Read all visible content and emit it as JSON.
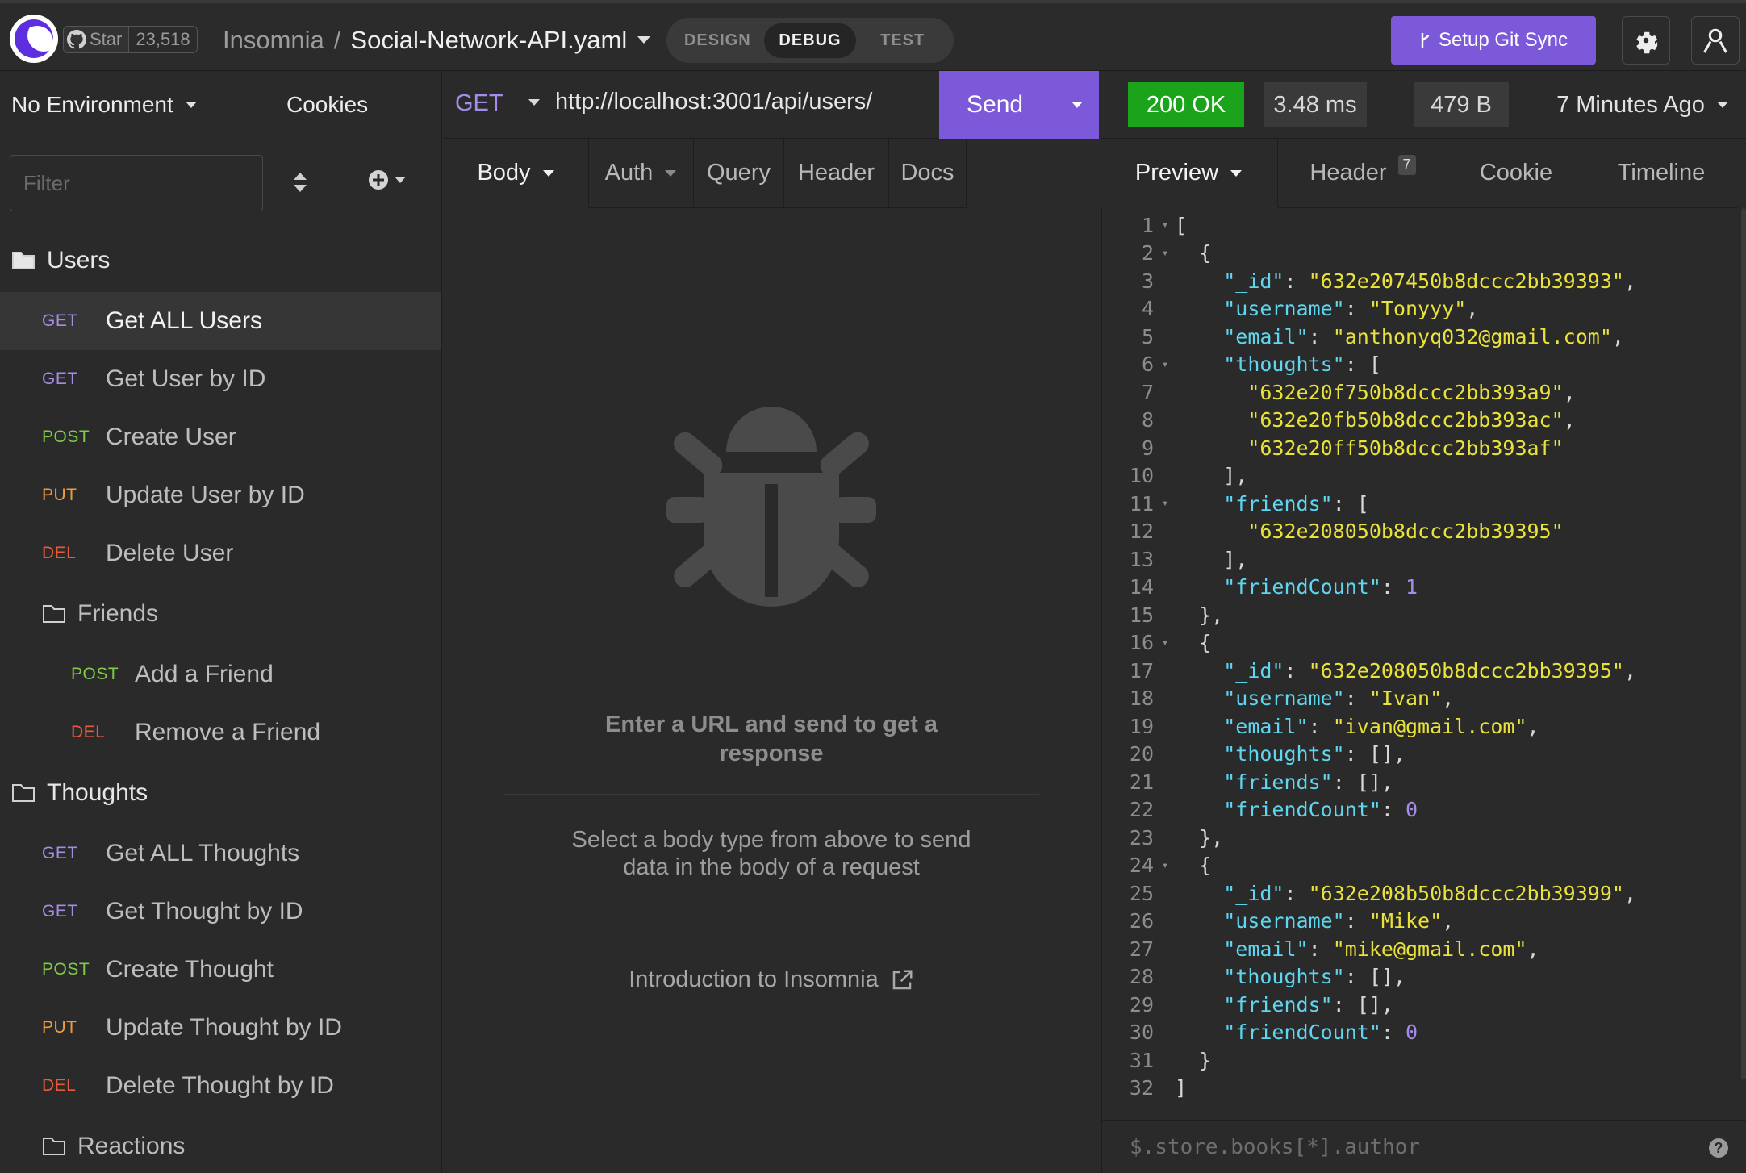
{
  "header": {
    "star_label": "Star",
    "star_count": "23,518",
    "org": "Insomnia",
    "separator": "/",
    "document": "Social-Network-API.yaml",
    "modes": [
      "DESIGN",
      "DEBUG",
      "TEST"
    ],
    "active_mode": "DEBUG",
    "git_sync_label": "Setup Git Sync"
  },
  "sidebar": {
    "environment": "No Environment",
    "cookies": "Cookies",
    "filter_placeholder": "Filter",
    "tree": [
      {
        "type": "folder",
        "name": "Users",
        "level": 0,
        "open": true
      },
      {
        "type": "request",
        "method": "GET",
        "name": "Get ALL Users",
        "level": 0,
        "active": true
      },
      {
        "type": "request",
        "method": "GET",
        "name": "Get User by ID",
        "level": 0
      },
      {
        "type": "request",
        "method": "POST",
        "name": "Create User",
        "level": 0
      },
      {
        "type": "request",
        "method": "PUT",
        "name": "Update User by ID",
        "level": 0
      },
      {
        "type": "request",
        "method": "DEL",
        "name": "Delete User",
        "level": 0
      },
      {
        "type": "folder",
        "name": "Friends",
        "level": 1,
        "open": false
      },
      {
        "type": "request",
        "method": "POST",
        "name": "Add a Friend",
        "level": 1
      },
      {
        "type": "request",
        "method": "DEL",
        "name": "Remove a Friend",
        "level": 1
      },
      {
        "type": "folder",
        "name": "Thoughts",
        "level": 0,
        "open": false
      },
      {
        "type": "request",
        "method": "GET",
        "name": "Get ALL Thoughts",
        "level": 0
      },
      {
        "type": "request",
        "method": "GET",
        "name": "Get Thought by ID",
        "level": 0
      },
      {
        "type": "request",
        "method": "POST",
        "name": "Create Thought",
        "level": 0
      },
      {
        "type": "request",
        "method": "PUT",
        "name": "Update Thought by ID",
        "level": 0
      },
      {
        "type": "request",
        "method": "DEL",
        "name": "Delete Thought by ID",
        "level": 0
      },
      {
        "type": "folder",
        "name": "Reactions",
        "level": 1,
        "open": false
      }
    ]
  },
  "request": {
    "method": "GET",
    "url": "http://localhost:3001/api/users/",
    "send_label": "Send",
    "tabs": [
      "Body",
      "Auth",
      "Query",
      "Header",
      "Docs"
    ],
    "empty_title": "Enter a URL and send to get a response",
    "empty_subtitle": "Select a body type from above to send data in the body of a request",
    "intro_link": "Introduction to Insomnia"
  },
  "response": {
    "status": "200 OK",
    "time": "3.48 ms",
    "size": "479 B",
    "age": "7 Minutes Ago",
    "tabs": [
      "Preview",
      "Header",
      "Cookie",
      "Timeline"
    ],
    "header_count": "7",
    "filter_placeholder": "$.store.books[*].author",
    "help": "?",
    "lines": [
      [
        [
          "t",
          "["
        ]
      ],
      [
        [
          "t",
          "  {"
        ]
      ],
      [
        [
          "t",
          "    "
        ],
        [
          "k",
          "\"_id\""
        ],
        [
          "t",
          ": "
        ],
        [
          "s",
          "\"632e207450b8dccc2bb39393\""
        ],
        [
          "t",
          ","
        ]
      ],
      [
        [
          "t",
          "    "
        ],
        [
          "k",
          "\"username\""
        ],
        [
          "t",
          ": "
        ],
        [
          "s",
          "\"Tonyyy\""
        ],
        [
          "t",
          ","
        ]
      ],
      [
        [
          "t",
          "    "
        ],
        [
          "k",
          "\"email\""
        ],
        [
          "t",
          ": "
        ],
        [
          "s",
          "\"anthonyq032@gmail.com\""
        ],
        [
          "t",
          ","
        ]
      ],
      [
        [
          "t",
          "    "
        ],
        [
          "k",
          "\"thoughts\""
        ],
        [
          "t",
          ": ["
        ]
      ],
      [
        [
          "t",
          "      "
        ],
        [
          "s",
          "\"632e20f750b8dccc2bb393a9\""
        ],
        [
          "t",
          ","
        ]
      ],
      [
        [
          "t",
          "      "
        ],
        [
          "s",
          "\"632e20fb50b8dccc2bb393ac\""
        ],
        [
          "t",
          ","
        ]
      ],
      [
        [
          "t",
          "      "
        ],
        [
          "s",
          "\"632e20ff50b8dccc2bb393af\""
        ]
      ],
      [
        [
          "t",
          "    ],"
        ]
      ],
      [
        [
          "t",
          "    "
        ],
        [
          "k",
          "\"friends\""
        ],
        [
          "t",
          ": ["
        ]
      ],
      [
        [
          "t",
          "      "
        ],
        [
          "s",
          "\"632e208050b8dccc2bb39395\""
        ]
      ],
      [
        [
          "t",
          "    ],"
        ]
      ],
      [
        [
          "t",
          "    "
        ],
        [
          "k",
          "\"friendCount\""
        ],
        [
          "t",
          ": "
        ],
        [
          "n",
          "1"
        ]
      ],
      [
        [
          "t",
          "  },"
        ]
      ],
      [
        [
          "t",
          "  {"
        ]
      ],
      [
        [
          "t",
          "    "
        ],
        [
          "k",
          "\"_id\""
        ],
        [
          "t",
          ": "
        ],
        [
          "s",
          "\"632e208050b8dccc2bb39395\""
        ],
        [
          "t",
          ","
        ]
      ],
      [
        [
          "t",
          "    "
        ],
        [
          "k",
          "\"username\""
        ],
        [
          "t",
          ": "
        ],
        [
          "s",
          "\"Ivan\""
        ],
        [
          "t",
          ","
        ]
      ],
      [
        [
          "t",
          "    "
        ],
        [
          "k",
          "\"email\""
        ],
        [
          "t",
          ": "
        ],
        [
          "s",
          "\"ivan@gmail.com\""
        ],
        [
          "t",
          ","
        ]
      ],
      [
        [
          "t",
          "    "
        ],
        [
          "k",
          "\"thoughts\""
        ],
        [
          "t",
          ": [],"
        ]
      ],
      [
        [
          "t",
          "    "
        ],
        [
          "k",
          "\"friends\""
        ],
        [
          "t",
          ": [],"
        ]
      ],
      [
        [
          "t",
          "    "
        ],
        [
          "k",
          "\"friendCount\""
        ],
        [
          "t",
          ": "
        ],
        [
          "n",
          "0"
        ]
      ],
      [
        [
          "t",
          "  },"
        ]
      ],
      [
        [
          "t",
          "  {"
        ]
      ],
      [
        [
          "t",
          "    "
        ],
        [
          "k",
          "\"_id\""
        ],
        [
          "t",
          ": "
        ],
        [
          "s",
          "\"632e208b50b8dccc2bb39399\""
        ],
        [
          "t",
          ","
        ]
      ],
      [
        [
          "t",
          "    "
        ],
        [
          "k",
          "\"username\""
        ],
        [
          "t",
          ": "
        ],
        [
          "s",
          "\"Mike\""
        ],
        [
          "t",
          ","
        ]
      ],
      [
        [
          "t",
          "    "
        ],
        [
          "k",
          "\"email\""
        ],
        [
          "t",
          ": "
        ],
        [
          "s",
          "\"mike@gmail.com\""
        ],
        [
          "t",
          ","
        ]
      ],
      [
        [
          "t",
          "    "
        ],
        [
          "k",
          "\"thoughts\""
        ],
        [
          "t",
          ": [],"
        ]
      ],
      [
        [
          "t",
          "    "
        ],
        [
          "k",
          "\"friends\""
        ],
        [
          "t",
          ": [],"
        ]
      ],
      [
        [
          "t",
          "    "
        ],
        [
          "k",
          "\"friendCount\""
        ],
        [
          "t",
          ": "
        ],
        [
          "n",
          "0"
        ]
      ],
      [
        [
          "t",
          "  }"
        ]
      ],
      [
        [
          "t",
          "]"
        ]
      ]
    ],
    "foldable_lines": [
      1,
      2,
      6,
      11,
      16,
      24
    ]
  },
  "colors": {
    "accent": "#7b59d9",
    "success": "#1ca31c",
    "get": "#a48ce8",
    "post": "#7fcb46",
    "put": "#ee9b3c",
    "delete": "#e85a3c"
  }
}
